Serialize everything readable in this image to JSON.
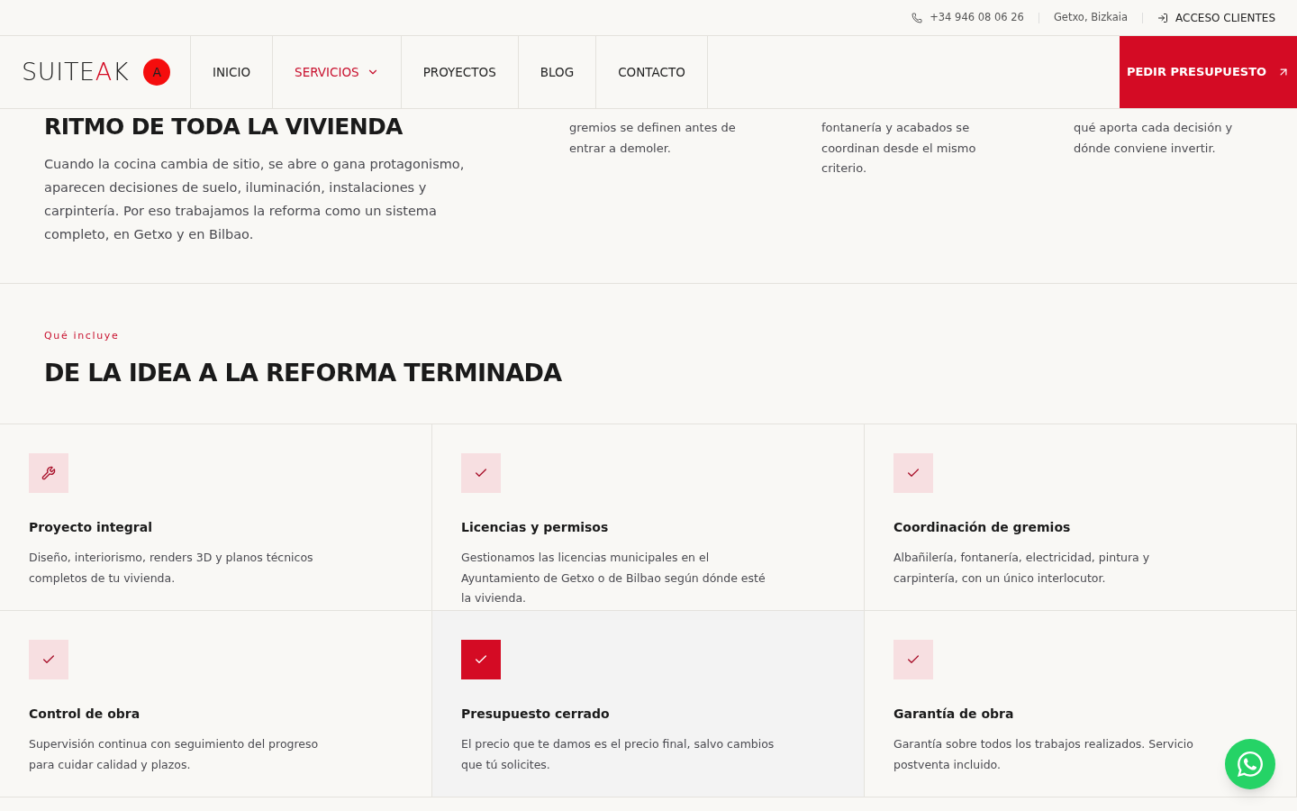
{
  "top_bar": {
    "phone": "+34 946 08 06 26",
    "location": "Getxo, Bizkaia",
    "login": "ACCESO CLIENTES"
  },
  "header": {
    "logo": [
      {
        "text": "SUITE",
        "accent": false
      },
      {
        "text": "A",
        "accent": true
      },
      {
        "text": "K",
        "accent": false
      }
    ],
    "logo_badge": "A",
    "nav": [
      {
        "label": "INICIO",
        "selected": false,
        "dropdown": false
      },
      {
        "label": "SERVICIOS",
        "selected": true,
        "dropdown": true
      },
      {
        "label": "PROYECTOS",
        "selected": false,
        "dropdown": false
      },
      {
        "label": "BLOG",
        "selected": false,
        "dropdown": false
      },
      {
        "label": "CONTACTO",
        "selected": false,
        "dropdown": false
      }
    ],
    "cta": "PEDIR PRESUPUESTO"
  },
  "intro": {
    "heading": "RITMO DE TODA LA VIVIENDA",
    "text": "Cuando la cocina cambia de sitio, se abre o gana protagonismo, aparecen decisiones de suelo, iluminación, instalaciones y carpintería. Por eso trabajamos la reforma como un sistema completo, en Getxo y en Bilbao.",
    "columns": [
      "gremios se definen antes de entrar a demoler.",
      "fontanería y acabados se coordinan desde el mismo criterio.",
      "qué aporta cada decisión y dónde conviene invertir."
    ]
  },
  "includes": {
    "eyebrow": "Qué incluye",
    "heading": "DE LA IDEA A LA REFORMA TERMINADA",
    "cards": [
      {
        "kind": "wrench",
        "title": "Proyecto integral",
        "text": "Diseño, interiorismo, renders 3D y planos técnicos completos de tu vivienda.",
        "highlighted": false
      },
      {
        "kind": "check",
        "title": "Licencias y permisos",
        "text": "Gestionamos las licencias municipales en el Ayuntamiento de Getxo o de Bilbao según dónde esté la vivienda.",
        "highlighted": false
      },
      {
        "kind": "check",
        "title": "Coordinación de gremios",
        "text": "Albañilería, fontanería, electricidad, pintura y carpintería, con un único interlocutor.",
        "highlighted": false
      },
      {
        "kind": "check",
        "title": "Control de obra",
        "text": "Supervisión continua con seguimiento del progreso para cuidar calidad y plazos.",
        "highlighted": false
      },
      {
        "kind": "check",
        "title": "Presupuesto cerrado",
        "text": "El precio que te damos es el precio final, salvo cambios que tú solicites.",
        "highlighted": true
      },
      {
        "kind": "check",
        "title": "Garantía de obra",
        "text": "Garantía sobre todos los trabajos realizados. Servicio postventa incluido.",
        "highlighted": false
      }
    ]
  }
}
